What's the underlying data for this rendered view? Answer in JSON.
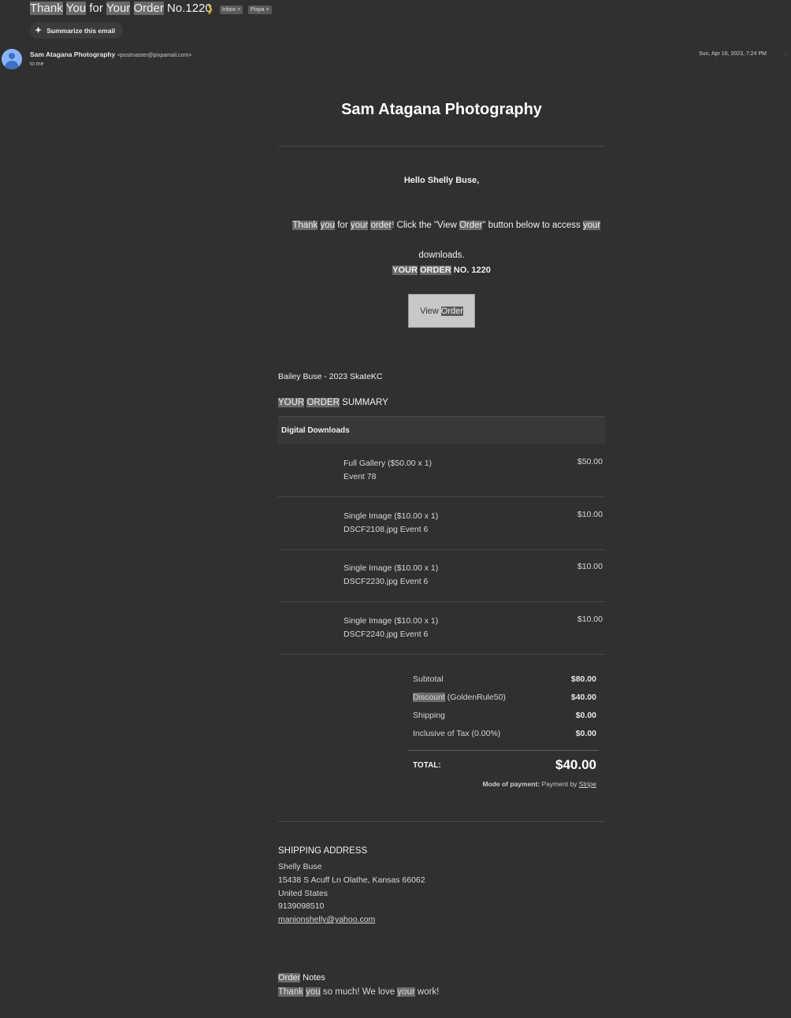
{
  "email": {
    "subject_parts": [
      "Thank",
      " ",
      "You",
      " for ",
      "Your",
      " ",
      "Order",
      " No.1220"
    ],
    "labels": [
      "Inbox ×",
      "Pixpa ×"
    ],
    "summarize_label": "Summarize this email",
    "sender_name": "Sam Atagana Photography",
    "sender_email": "<postmaster@pixpamail.com>",
    "to": "to me",
    "date": "Sun, Apr 16, 2023, 7:24 PM",
    "avatar_color": "#8ab4f8"
  },
  "body": {
    "title": "Sam Atagana Photography",
    "greeting": "Hello Shelly Buse,",
    "thanks_line1": [
      "Thank",
      " ",
      "you",
      " for ",
      "your",
      " ",
      "order",
      "! Click the \"View ",
      "Order",
      "\" button below to access ",
      "your"
    ],
    "thanks_line2": "downloads.",
    "order_no_parts": [
      "YOUR",
      " ",
      "ORDER",
      " NO. 1220"
    ],
    "view_btn": [
      "View ",
      "Order"
    ],
    "gallery": "Bailey Buse - 2023 SkateKC",
    "summary_parts": [
      "YOUR",
      " ",
      "ORDER",
      " SUMMARY"
    ],
    "section": "Digital Downloads",
    "items": [
      {
        "line1": "Full Gallery ($50.00 x 1)",
        "line2": "Event 78",
        "price": "$50.00"
      },
      {
        "line1": "Single Image ($10.00 x 1)",
        "line2": "DSCF2108.jpg Event 6",
        "price": "$10.00"
      },
      {
        "line1": "Single Image ($10.00 x 1)",
        "line2": "DSCF2230.jpg Event 6",
        "price": "$10.00"
      },
      {
        "line1": "Single Image ($10.00 x 1)",
        "line2": "DSCF2240.jpg Event 6",
        "price": "$10.00"
      }
    ],
    "totals": {
      "subtotal_label": "Subtotal",
      "subtotal": "$80.00",
      "discount_label": "Discount",
      "discount_code": " (GoldenRule50)",
      "discount": "$40.00",
      "shipping_label": "Shipping",
      "shipping": "$0.00",
      "tax_label": "Inclusive of Tax (0.00%)",
      "tax": "$0.00",
      "total_label": "TOTAL:",
      "total": "$40.00",
      "mop_label": "Mode of payment:",
      "mop_text": " Payment by ",
      "mop_provider": "Stripe"
    },
    "shipping": {
      "heading": "SHIPPING ADDRESS",
      "name": "Shelly Buse",
      "street": "15438 S Acuff Ln Olathe, Kansas 66062",
      "country": "United States",
      "phone": "9139098510",
      "email": "manionshelly@yahoo.com"
    },
    "notes": {
      "heading_parts": [
        "Order",
        " Notes"
      ],
      "text_parts": [
        "Thank",
        " ",
        "you",
        " so much! We love ",
        "your",
        " work!"
      ]
    }
  }
}
